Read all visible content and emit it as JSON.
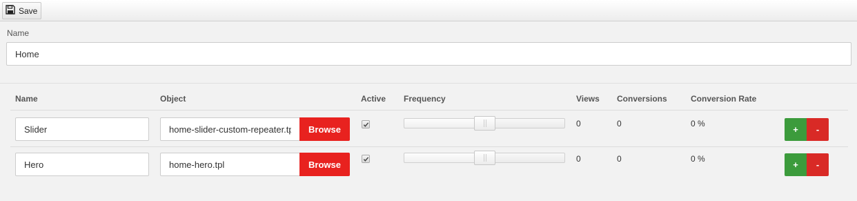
{
  "toolbar": {
    "save_label": "Save",
    "save_icon": "floppy-disk-icon"
  },
  "page": {
    "name_label": "Name",
    "name_value": "Home"
  },
  "table": {
    "headers": [
      "Name",
      "Object",
      "Active",
      "Frequency",
      "Views",
      "Conversions",
      "Conversion Rate"
    ],
    "browse_label": "Browse",
    "plus_label": "+",
    "minus_label": "-",
    "rows": [
      {
        "name": "Slider",
        "object": "home-slider-custom-repeater.tpl",
        "active": true,
        "frequency": 0.5,
        "views": "0",
        "conversions": "0",
        "conversion_rate": "0 %"
      },
      {
        "name": "Hero",
        "object": "home-hero.tpl",
        "active": true,
        "frequency": 0.5,
        "views": "0",
        "conversions": "0",
        "conversion_rate": "0 %"
      }
    ]
  },
  "colors": {
    "browse": "#e8221f",
    "plus": "#3c9b3c",
    "minus": "#d92a26"
  }
}
